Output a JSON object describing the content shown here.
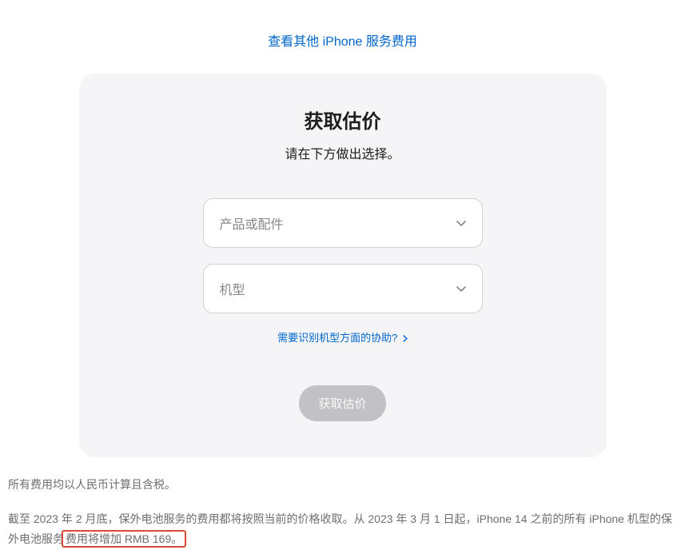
{
  "topLink": {
    "label": "查看其他 iPhone 服务费用"
  },
  "card": {
    "title": "获取估价",
    "subtitle": "请在下方做出选择。",
    "select1": {
      "placeholder": "产品或配件"
    },
    "select2": {
      "placeholder": "机型"
    },
    "helpLink": {
      "label": "需要识别机型方面的协助?"
    },
    "submitButton": {
      "label": "获取估价"
    }
  },
  "footer": {
    "line1": "所有费用均以人民币计算且含税。",
    "line2_part1": "截至 2023 年 2 月底，保外电池服务的费用都将按照当前的价格收取。从 2023 年 3 月 1 日起，iPhone 14 之前的所有 iPhone 机型的保外电池服务",
    "line2_part2": "费用将增加 RMB 169。"
  }
}
